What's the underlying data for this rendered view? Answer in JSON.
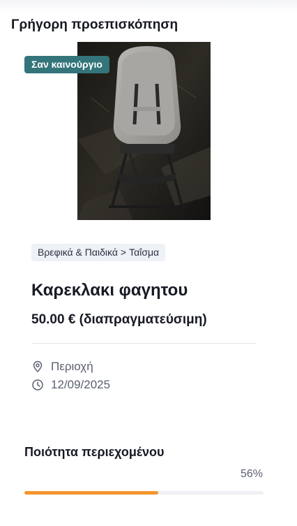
{
  "panel": {
    "title": "Γρήγορη προεπισκόπηση"
  },
  "listing": {
    "condition_badge": "Σαν καινούργιο",
    "category": {
      "parent": "Βρεφικά & Παιδικά",
      "separator": ">",
      "child": "Ταΐσμα"
    },
    "title": "Καρεκλακι φαγητου",
    "price": "50.00 € (διαπραγματεύσιμη)",
    "location": "Περιοχή",
    "date": "12/09/2025",
    "location_icon": "map-pin-icon",
    "date_icon": "clock-icon"
  },
  "quality": {
    "title": "Ποιότητα περιεχομένου",
    "percent_label": "56%",
    "percent_value": 56
  },
  "colors": {
    "badge_bg": "#33757a",
    "progress_fill": "#f3952e",
    "progress_track": "#eef0f5",
    "chip_bg": "#eef1f6"
  }
}
